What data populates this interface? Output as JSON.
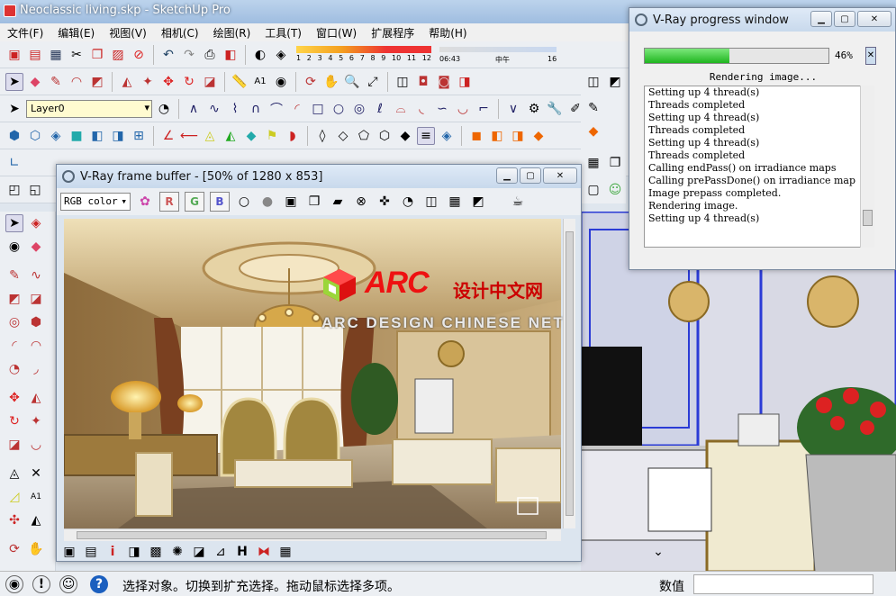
{
  "app": {
    "title": "Neoclassic living.skp - SketchUp Pro"
  },
  "menu": [
    "文件(F)",
    "编辑(E)",
    "视图(V)",
    "相机(C)",
    "绘图(R)",
    "工具(T)",
    "窗口(W)",
    "扩展程序",
    "帮助(H)"
  ],
  "toolbar": {
    "layer_value": "Layer0",
    "shadow_month_ticks": [
      "1",
      "2",
      "3",
      "4",
      "5",
      "6",
      "7",
      "8",
      "9",
      "10",
      "11",
      "12"
    ],
    "shadow_time_start": "06:43",
    "shadow_time_mid": "中午",
    "shadow_time_end": "16"
  },
  "frame_buffer": {
    "title": "V-Ray frame buffer - [50% of 1280 x 853]",
    "channel": "RGB color",
    "channel_buttons": [
      "R",
      "G",
      "B"
    ]
  },
  "progress_window": {
    "title": "V-Ray progress window",
    "percent_label": "46%",
    "progress": 0.46,
    "status": "Rendering image...",
    "log": [
      "Setting up 4 thread(s)",
      "Threads completed",
      "Setting up 4 thread(s)",
      "Threads completed",
      "Setting up 4 thread(s)",
      "Threads completed",
      "Calling endPass() on irradiance maps",
      "Calling prePassDone() on irradiance map",
      "Image prepass completed.",
      "Rendering image.",
      "Setting up 4 thread(s)"
    ]
  },
  "watermark": {
    "brand": "ARC",
    "chinese": "设计中文网",
    "english": "ARC DESIGN CHINESE NET"
  },
  "status": {
    "message": "选择对象。切换到扩充选择。拖动鼠标选择多项。",
    "vcb_label": "数值"
  },
  "colors": {
    "accent": "#1fb51f",
    "brand_red": "#e11111"
  }
}
